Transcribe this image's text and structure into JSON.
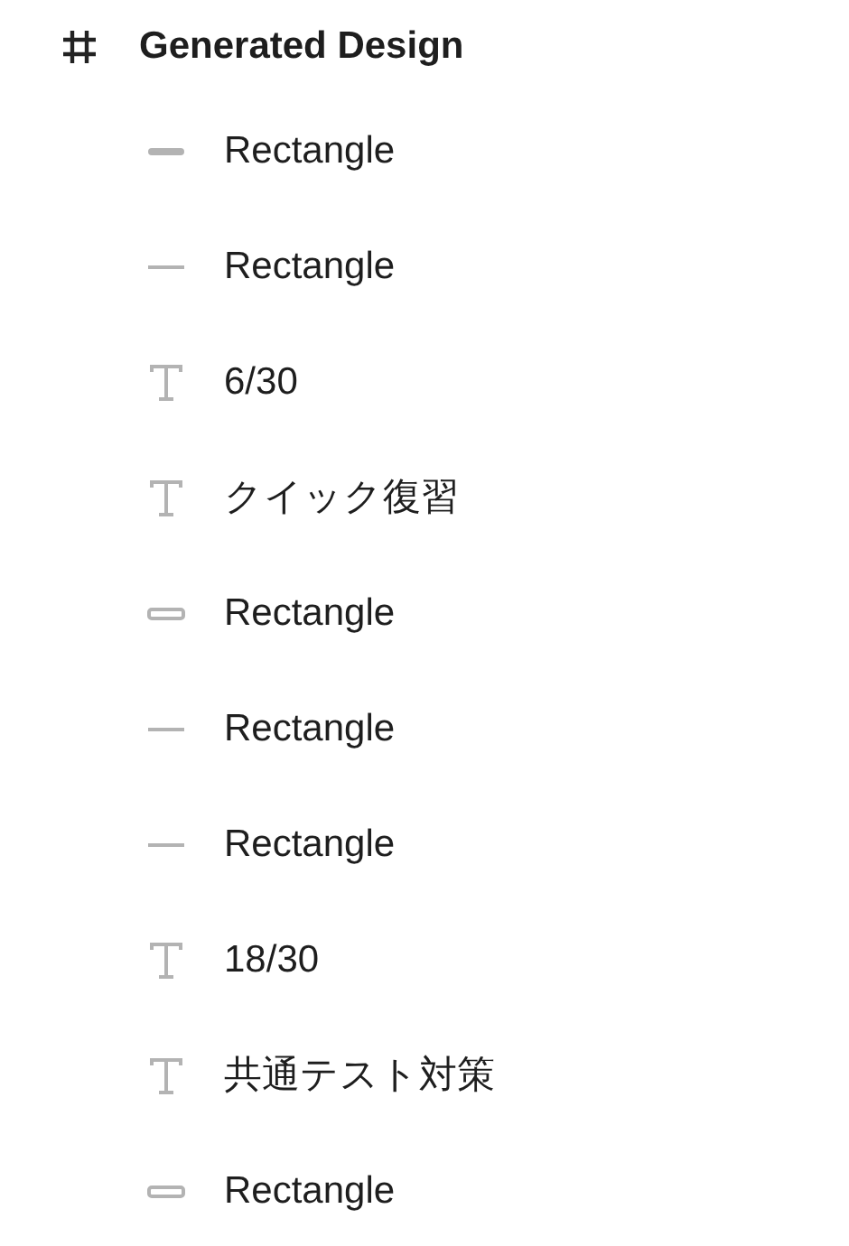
{
  "frame": {
    "name": "Generated Design",
    "children": [
      {
        "kind": "pill",
        "name": "Rectangle"
      },
      {
        "kind": "line",
        "name": "Rectangle"
      },
      {
        "kind": "text",
        "name": "6/30"
      },
      {
        "kind": "text",
        "name": "クイック復習"
      },
      {
        "kind": "outline",
        "name": "Rectangle"
      },
      {
        "kind": "line",
        "name": "Rectangle"
      },
      {
        "kind": "line",
        "name": "Rectangle"
      },
      {
        "kind": "text",
        "name": "18/30"
      },
      {
        "kind": "text",
        "name": "共通テスト対策"
      },
      {
        "kind": "outline",
        "name": "Rectangle"
      }
    ]
  }
}
